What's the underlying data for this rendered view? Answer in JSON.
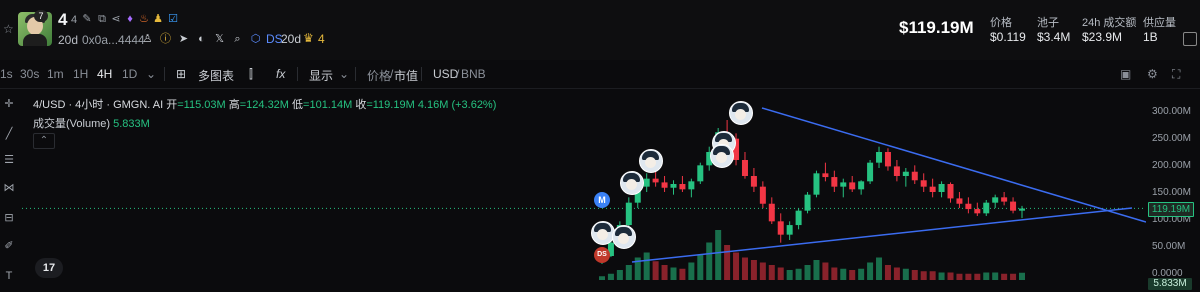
{
  "token": {
    "symbol": "4",
    "symbol_sub": "4",
    "age": "20d",
    "address": "0x0a...4444",
    "avatar_badge": "7",
    "ds_label": "DS",
    "ds_age": "20d",
    "crown_count": "4"
  },
  "header_stats": {
    "market_cap": "$119.19M",
    "items": [
      {
        "label": "价格",
        "value": "$0.119"
      },
      {
        "label": "池子",
        "value": "$3.4M"
      },
      {
        "label": "24h 成交额",
        "value": "$23.9M"
      },
      {
        "label": "供应量",
        "value": "1B"
      }
    ]
  },
  "toolbar": {
    "timeframes": [
      "1s",
      "30s",
      "1m",
      "1H",
      "4H",
      "1D"
    ],
    "active_timeframe": "4H",
    "multi_chart": "多图表",
    "display": "显示",
    "price_label": "价格",
    "separator": "/",
    "mcap_label": "市值",
    "quote_usd": "USD",
    "quote_bnb": "BNB"
  },
  "legend": {
    "title": "4/USD · 4小时 · GMGN. AI",
    "open_label": "开",
    "open": "=115.03M",
    "high_label": "高",
    "high": "=124.32M",
    "low_label": "低",
    "low": "=101.14M",
    "close_label": "收",
    "close": "=119.19M",
    "change": "4.16M (+3.62%)",
    "volume_label": "成交量(Volume)",
    "volume": "5.833M"
  },
  "axis": {
    "ticks": [
      "300.00M",
      "250.00M",
      "200.00M",
      "150.00M",
      "100.00M",
      "50.00M",
      "0.0000"
    ],
    "current_price": "119.19M",
    "current_volume": "5.833M"
  },
  "markers": {
    "m_letter": "M",
    "ds_letter": "DS"
  },
  "colors": {
    "up": "#26c281",
    "down": "#f23645",
    "trendline": "#3b6cf0",
    "ds": "#5b8cff",
    "crown": "#e6b93c"
  },
  "chart_data": {
    "type": "candlestick",
    "title": "4/USD · 4小时 · GMGN. AI",
    "ylim": [
      0,
      320
    ],
    "y_unit": "M",
    "series": [
      {
        "name": "4/USD",
        "ohlc": [
          [
            20,
            35,
            15,
            30
          ],
          [
            30,
            60,
            28,
            55
          ],
          [
            55,
            95,
            50,
            88
          ],
          [
            88,
            140,
            80,
            130
          ],
          [
            130,
            170,
            120,
            160
          ],
          [
            160,
            185,
            150,
            175
          ],
          [
            175,
            190,
            160,
            168
          ],
          [
            168,
            180,
            150,
            158
          ],
          [
            158,
            172,
            145,
            165
          ],
          [
            165,
            180,
            150,
            155
          ],
          [
            155,
            175,
            140,
            170
          ],
          [
            170,
            205,
            165,
            200
          ],
          [
            200,
            235,
            190,
            225
          ],
          [
            225,
            270,
            215,
            262
          ],
          [
            262,
            285,
            240,
            250
          ],
          [
            250,
            260,
            200,
            210
          ],
          [
            210,
            225,
            175,
            180
          ],
          [
            180,
            195,
            150,
            160
          ],
          [
            160,
            170,
            120,
            128
          ],
          [
            128,
            140,
            90,
            95
          ],
          [
            95,
            110,
            55,
            70
          ],
          [
            70,
            95,
            60,
            88
          ],
          [
            88,
            120,
            80,
            115
          ],
          [
            115,
            150,
            110,
            145
          ],
          [
            145,
            190,
            140,
            185
          ],
          [
            185,
            205,
            170,
            178
          ],
          [
            178,
            190,
            150,
            160
          ],
          [
            160,
            175,
            140,
            168
          ],
          [
            168,
            180,
            150,
            155
          ],
          [
            155,
            172,
            145,
            170
          ],
          [
            170,
            210,
            165,
            205
          ],
          [
            205,
            235,
            195,
            225
          ],
          [
            225,
            232,
            190,
            198
          ],
          [
            198,
            210,
            170,
            180
          ],
          [
            180,
            195,
            160,
            188
          ],
          [
            188,
            200,
            165,
            172
          ],
          [
            172,
            185,
            150,
            160
          ],
          [
            160,
            175,
            140,
            150
          ],
          [
            150,
            170,
            140,
            165
          ],
          [
            165,
            168,
            130,
            138
          ],
          [
            138,
            150,
            120,
            128
          ],
          [
            128,
            140,
            110,
            118
          ],
          [
            118,
            130,
            105,
            110
          ],
          [
            110,
            135,
            105,
            130
          ],
          [
            130,
            145,
            120,
            140
          ],
          [
            140,
            150,
            125,
            132
          ],
          [
            132,
            140,
            110,
            115
          ],
          [
            115,
            124,
            101,
            119
          ]
        ]
      },
      {
        "name": "成交量(Volume)",
        "values": [
          3,
          5,
          8,
          12,
          18,
          22,
          15,
          12,
          10,
          9,
          14,
          20,
          30,
          40,
          28,
          22,
          18,
          16,
          14,
          12,
          10,
          8,
          9,
          12,
          16,
          14,
          10,
          9,
          8,
          9,
          14,
          18,
          12,
          10,
          9,
          8,
          7,
          7,
          6,
          6,
          5,
          5,
          5,
          6,
          6,
          5,
          5,
          5.8
        ]
      }
    ],
    "trendlines": [
      {
        "from": [
          0,
          300
        ],
        "to": [
          47,
          100
        ],
        "label": "upper"
      },
      {
        "from": [
          0,
          10
        ],
        "to": [
          47,
          110
        ],
        "label": "lower"
      }
    ],
    "current": 119.19
  }
}
